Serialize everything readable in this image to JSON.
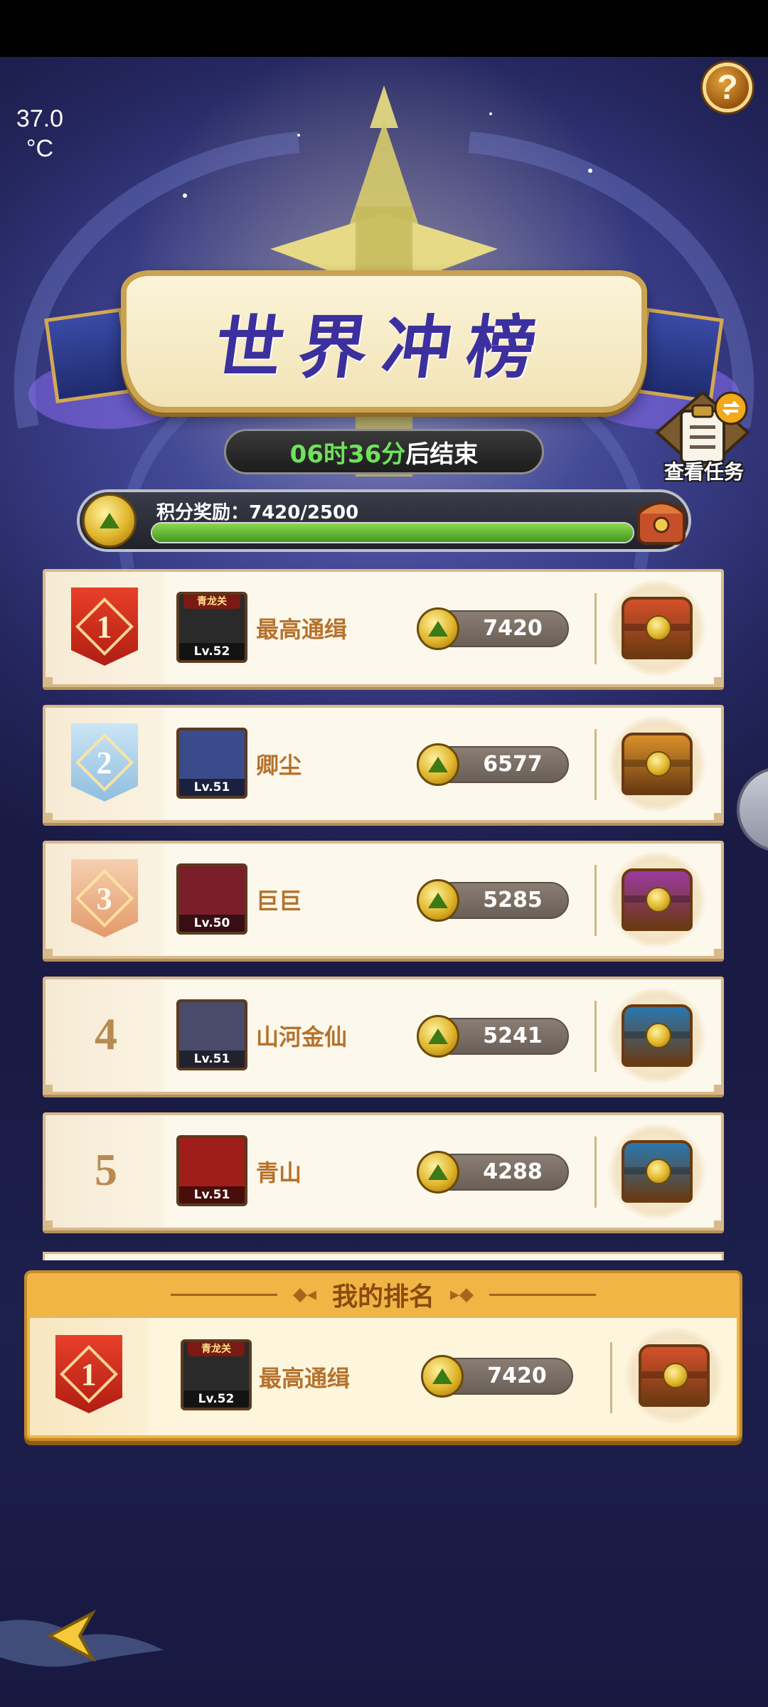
{
  "status": {
    "temperature_value": "37.0",
    "temperature_unit": "°C"
  },
  "header": {
    "title": "世界冲榜",
    "timer_time": "06时36分",
    "timer_suffix": "后结束",
    "task_button_label": "查看任务"
  },
  "reward": {
    "label": "积分奖励：7420/2500",
    "progress_fraction": 1.0
  },
  "ranking": [
    {
      "rank": "1",
      "rank_style": "gold",
      "name": "最高通缉",
      "level": "Lv.52",
      "tag": "青龙关",
      "score": "7420",
      "chest_color": "#d4502a",
      "avatar_bg": "#2a2a2a"
    },
    {
      "rank": "2",
      "rank_style": "silver",
      "name": "卿尘",
      "level": "Lv.51",
      "tag": "",
      "score": "6577",
      "chest_color": "#d9902a",
      "avatar_bg": "#3a4a8a"
    },
    {
      "rank": "3",
      "rank_style": "bronze",
      "name": "巨巨",
      "level": "Lv.50",
      "tag": "",
      "score": "5285",
      "chest_color": "#9b3aa0",
      "avatar_bg": "#7a1f2a"
    },
    {
      "rank": "4",
      "rank_style": "plain",
      "name": "山河金仙",
      "level": "Lv.51",
      "tag": "",
      "score": "5241",
      "chest_color": "#2a78b0",
      "avatar_bg": "#4a4a6a"
    },
    {
      "rank": "5",
      "rank_style": "plain",
      "name": "青山",
      "level": "Lv.51",
      "tag": "",
      "score": "4288",
      "chest_color": "#2a78b0",
      "avatar_bg": "#a01e1a"
    }
  ],
  "my_ranking": {
    "title": "我的排名",
    "rank": "1",
    "name": "最高通缉",
    "level": "Lv.52",
    "tag": "青龙关",
    "score": "7420",
    "chest_color": "#d4502a",
    "avatar_bg": "#2a2a2a"
  },
  "icons": {
    "help": "?",
    "task": "clipboard-icon",
    "back": "chevron-left-icon",
    "coin": "coin-icon"
  }
}
